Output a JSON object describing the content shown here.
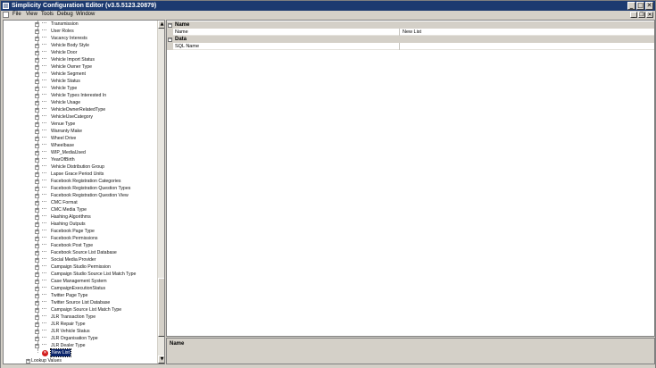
{
  "window": {
    "title": "Simplicity Configuration Editor (v3.5.5123.20879)",
    "min_glyph": "_",
    "max_glyph": "□",
    "close_glyph": "✕"
  },
  "menu": {
    "items": [
      "File",
      "View",
      "Tools",
      "Debug",
      "Window"
    ],
    "mdi_min_glyph": "_",
    "mdi_restore_glyph": "❐",
    "mdi_close_glyph": "✕"
  },
  "tree": {
    "expand_glyph": "+",
    "items": [
      "Transmission",
      "User Roles",
      "Vacancy Interests",
      "Vehicle Body Style",
      "Vehicle Door",
      "Vehicle Import Status",
      "Vehicle Owner Type",
      "Vehicle Segment",
      "Vehicle Status",
      "Vehicle Type",
      "Vehicle Types Interested In",
      "Vehicle Usage",
      "VehicleOwnerRelatedType",
      "VehicleUseCategory",
      "Venue Type",
      "Warranty Make",
      "Wheel Drive",
      "Wheelbase",
      "WIP_MediaUsed",
      "YearOfBirth",
      "Vehicle Distribution Group",
      "Lapse Grace Period Units",
      "Facebook Registration Categories",
      "Facebook Registration Question Types",
      "Facebook Registration Question View",
      "CMC Format",
      "CMC Media Type",
      "Hashing Algorithms",
      "Hashing Outputs",
      "Facebook Page Type",
      "Facebook Permissions",
      "Facebook Post Type",
      "Facebook Source List Database",
      "Social Media Provider",
      "Campaign Studio Permission",
      "Campaign Studio Source List Match Type",
      "Case Management System",
      "CampaignExecutionStatus",
      "Twitter Page Type",
      "Twitter Source List Database",
      "Campaign Source List Match Type",
      "JLR Transaction Type",
      "JLR Repair Type",
      "JLR Vehicle Status",
      "JLR Organisation Type",
      "JLR Dealer Type"
    ],
    "selected": "New List",
    "error_glyph": "✕",
    "bottom_item": "Lookup Values"
  },
  "scrollbar": {
    "up_glyph": "▲",
    "down_glyph": "▼"
  },
  "properties": {
    "collapse_glyph": "−",
    "categories": [
      {
        "name": "Name",
        "rows": [
          {
            "name": "Name",
            "value": "New List"
          }
        ]
      },
      {
        "name": "Data",
        "rows": [
          {
            "name": "SQL Name",
            "value": ""
          }
        ]
      }
    ]
  },
  "description": {
    "title": "Name"
  }
}
